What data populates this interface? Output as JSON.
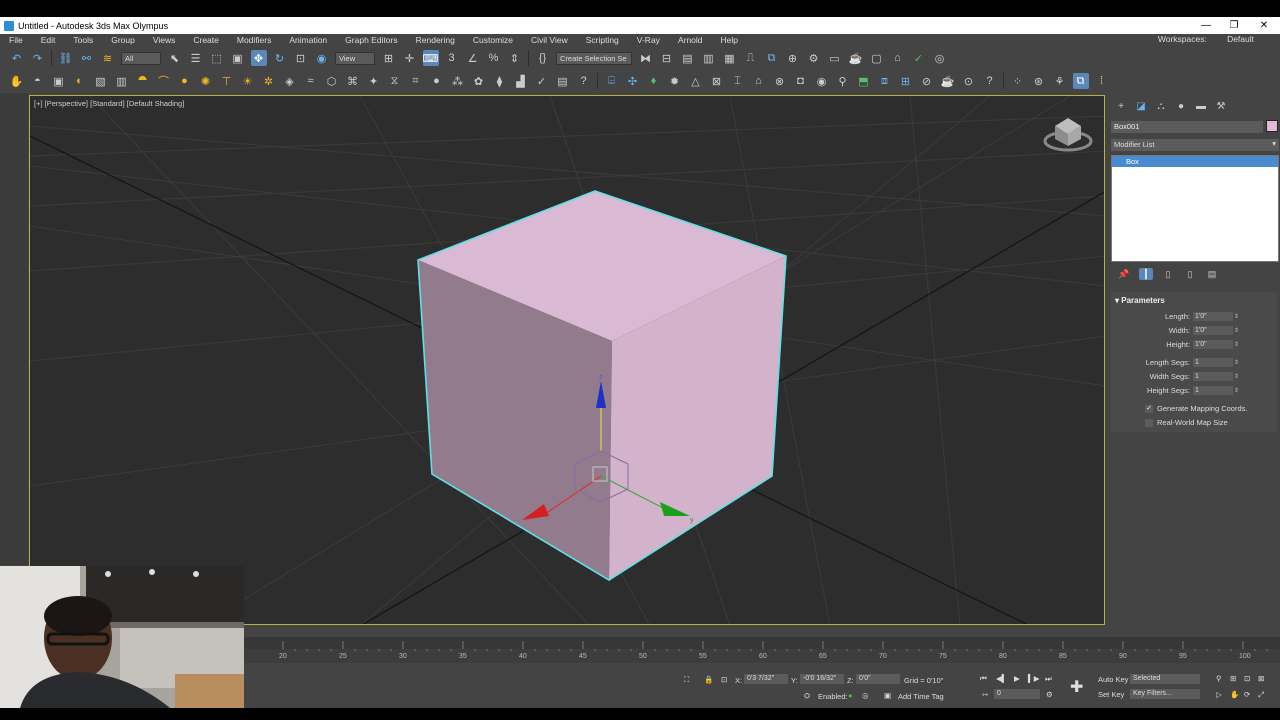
{
  "window": {
    "title": "Untitled - Autodesk 3ds Max Olympus"
  },
  "menu": {
    "items": [
      "File",
      "Edit",
      "Tools",
      "Group",
      "Views",
      "Create",
      "Modifiers",
      "Animation",
      "Graph Editors",
      "Rendering",
      "Customize",
      "Civil View",
      "Scripting",
      "V-Ray",
      "Arnold",
      "Help"
    ],
    "workspaces_label": "Workspaces:",
    "workspaces_value": "Default"
  },
  "toolbar": {
    "filter_dropdown": "All",
    "refcoord_dropdown": "View",
    "selection_set": "Create Selection Se"
  },
  "viewport": {
    "label": "[+] [Perspective] [Standard] [Default Shading]",
    "object_color": "#e6b8d8",
    "selection_outline_color": "#5fe0e6",
    "border_color": "#b8b14a",
    "gizmo_labels": {
      "z": "z",
      "y": "y",
      "x": "x"
    }
  },
  "command_panel": {
    "object_name": "Box001",
    "object_color": "#e6b8d8",
    "modifier_list": "Modifier List",
    "stack_item": "Box",
    "rollout_title": "Parameters",
    "params": [
      {
        "label": "Length:",
        "value": "1'0\""
      },
      {
        "label": "Width:",
        "value": "1'0\""
      },
      {
        "label": "Height:",
        "value": "1'0\""
      },
      {
        "label": "Length Segs:",
        "value": "1"
      },
      {
        "label": "Width Segs:",
        "value": "1"
      },
      {
        "label": "Height Segs:",
        "value": "1"
      }
    ],
    "checkboxes": [
      {
        "label": "Generate Mapping Coords.",
        "checked": true
      },
      {
        "label": "Real-World Map Size",
        "checked": false
      }
    ]
  },
  "timeline": {
    "ticks": [
      "20",
      "25",
      "30",
      "35",
      "40",
      "45",
      "50",
      "55",
      "60",
      "65",
      "70",
      "75",
      "80",
      "85",
      "90",
      "95",
      "100"
    ]
  },
  "status": {
    "x_label": "X:",
    "x_value": "0'3 7/32\"",
    "y_label": "Y:",
    "y_value": "-0'0 16/32\"",
    "z_label": "Z:",
    "z_value": "0'0\"",
    "grid": "Grid = 0'10\"",
    "enabled": "Enabled:",
    "add_time_tag": "Add Time Tag",
    "frame": "0",
    "auto_key": "Auto Key",
    "selected": "Selected",
    "set_key": "Set Key",
    "key_filters": "Key Filters..."
  }
}
